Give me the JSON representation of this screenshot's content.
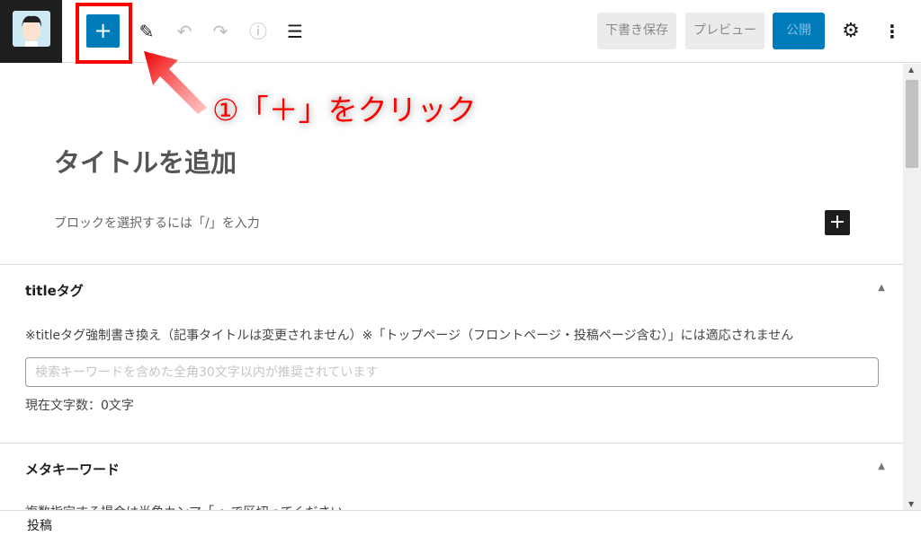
{
  "toolbar": {
    "add_label": "+",
    "draft_label": "下書き保存",
    "preview_label": "プレビュー",
    "publish_label": "公開",
    "icons": [
      "edit-icon",
      "undo-icon",
      "redo-icon",
      "info-icon",
      "list-view-icon",
      "gear-icon",
      "more-vertical-icon"
    ]
  },
  "annotation": "①「＋」をクリック",
  "editor": {
    "title_placeholder": "タイトルを追加",
    "block_placeholder": "ブロックを選択するには「/」を入力",
    "block_add": "+"
  },
  "title_panel": {
    "heading": "titleタグ",
    "note": "※titleタグ強制書き換え（記事タイトルは変更されません）※「トップページ（フロントページ・投稿ページ含む）」には適応されません",
    "placeholder": "検索キーワードを含めた全角30文字以内が推奨されています",
    "count": "現在文字数：0文字"
  },
  "meta_panel": {
    "heading": "メタキーワード",
    "note": "複数指定する場合は半角カンマ「,」で区切ってください"
  },
  "footer": {
    "breadcrumb": "投稿"
  },
  "colors": {
    "accent": "#007cba",
    "highlight": "#ff0000"
  }
}
